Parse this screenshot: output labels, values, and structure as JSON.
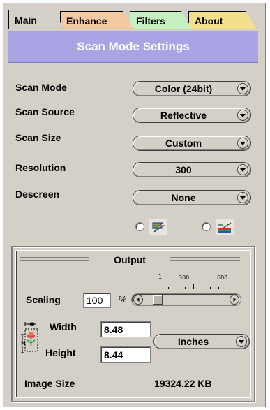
{
  "tabs": [
    {
      "label": "Main",
      "color": "#d4d0c8",
      "active": true
    },
    {
      "label": "Enhance",
      "color": "#f4c9a2",
      "active": false
    },
    {
      "label": "Filters",
      "color": "#c6f0c0",
      "active": false
    },
    {
      "label": "About",
      "color": "#f3e08a",
      "active": false
    }
  ],
  "header": {
    "title": "Scan Mode Settings",
    "color": "#a9a4e4"
  },
  "settings": [
    {
      "label": "Scan Mode",
      "value": "Color (24bit)"
    },
    {
      "label": "Scan Source",
      "value": "Reflective"
    },
    {
      "label": "Scan Size",
      "value": "Custom"
    },
    {
      "label": "Resolution",
      "value": "300"
    },
    {
      "label": "Descreen",
      "value": "None"
    }
  ],
  "mode_icons": [
    "color-mode-icon",
    "gamma-mode-icon"
  ],
  "output": {
    "title": "Output",
    "scaling_label": "Scaling",
    "scaling_value": "100",
    "percent_sign": "%",
    "scale_marks": [
      "1",
      "300",
      "600"
    ],
    "slider_fraction": 0.11,
    "width_label": "Width",
    "width_value": "8.48",
    "height_label": "Height",
    "height_value": "8.44",
    "unit": "Inches",
    "dimension_icon": "flower-dimension-icon",
    "image_size_label": "Image Size",
    "image_size_value": "19324.22 KB"
  }
}
